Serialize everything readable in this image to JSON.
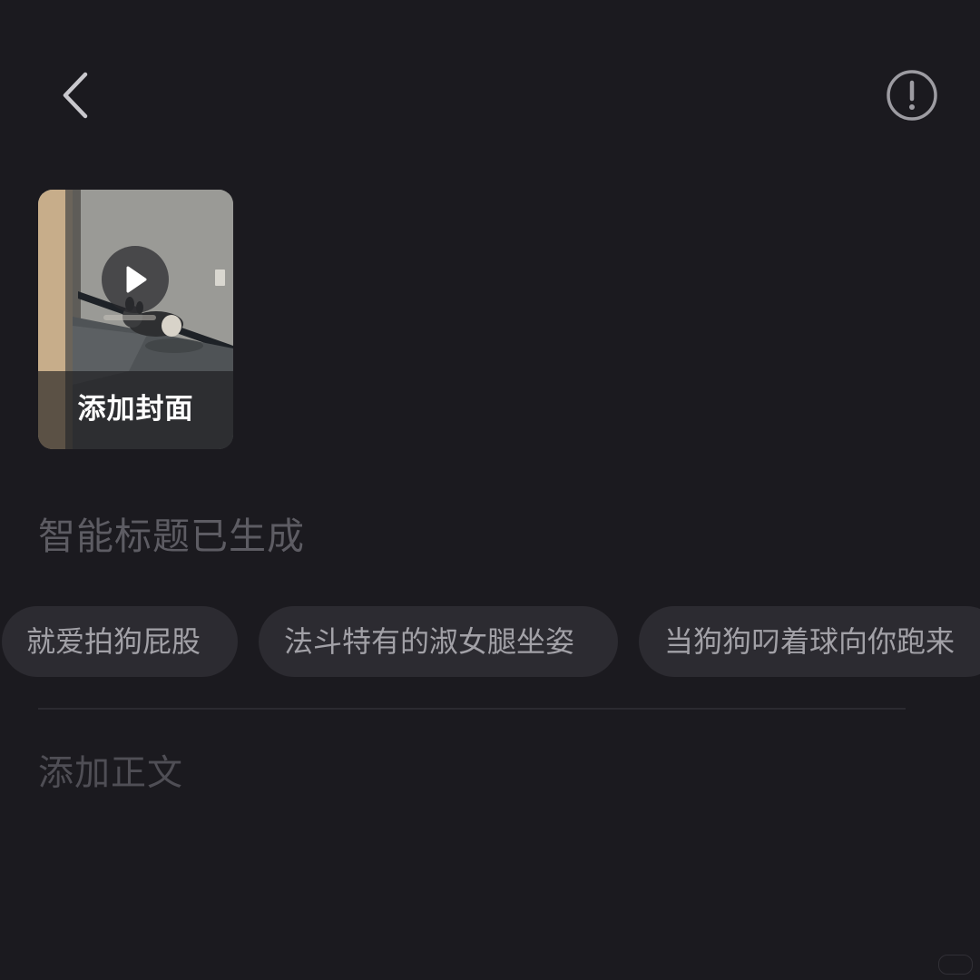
{
  "header": {
    "back_icon": "chevron-left-icon",
    "info_icon": "exclamation-circle-icon"
  },
  "cover": {
    "label": "添加封面",
    "play_icon": "play-icon"
  },
  "smart_title": {
    "text": "智能标题已生成"
  },
  "title_suggestions": [
    {
      "label": "就爱拍狗屁股"
    },
    {
      "label": "法斗特有的淑女腿坐姿"
    },
    {
      "label": "当狗狗叼着球向你跑来"
    }
  ],
  "body": {
    "placeholder": "添加正文"
  },
  "colors": {
    "background": "#1b1a1f",
    "chip_background": "#2c2b31",
    "chip_text": "#a2a1a7",
    "muted_text": "#5d5c63"
  }
}
